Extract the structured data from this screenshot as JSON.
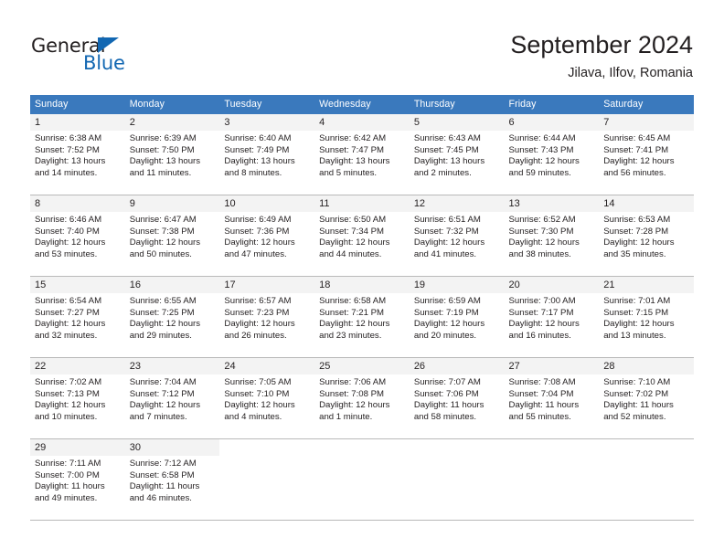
{
  "brand": {
    "name_top": "General",
    "name_bottom": "Blue",
    "triangle_icon": "blue-triangle-icon",
    "accent_color": "#1267b2"
  },
  "header": {
    "title": "September 2024",
    "location": "Jilava, Ilfov, Romania"
  },
  "theme": {
    "header_blue": "#3a79bd",
    "day_band_gray": "#f3f3f3",
    "grid_line": "#b9b9b9",
    "text": "#231f20"
  },
  "weekdays": [
    "Sunday",
    "Monday",
    "Tuesday",
    "Wednesday",
    "Thursday",
    "Friday",
    "Saturday"
  ],
  "weeks": [
    [
      {
        "day": "1",
        "sunrise": "Sunrise: 6:38 AM",
        "sunset": "Sunset: 7:52 PM",
        "daylight_1": "Daylight: 13 hours",
        "daylight_2": "and 14 minutes."
      },
      {
        "day": "2",
        "sunrise": "Sunrise: 6:39 AM",
        "sunset": "Sunset: 7:50 PM",
        "daylight_1": "Daylight: 13 hours",
        "daylight_2": "and 11 minutes."
      },
      {
        "day": "3",
        "sunrise": "Sunrise: 6:40 AM",
        "sunset": "Sunset: 7:49 PM",
        "daylight_1": "Daylight: 13 hours",
        "daylight_2": "and 8 minutes."
      },
      {
        "day": "4",
        "sunrise": "Sunrise: 6:42 AM",
        "sunset": "Sunset: 7:47 PM",
        "daylight_1": "Daylight: 13 hours",
        "daylight_2": "and 5 minutes."
      },
      {
        "day": "5",
        "sunrise": "Sunrise: 6:43 AM",
        "sunset": "Sunset: 7:45 PM",
        "daylight_1": "Daylight: 13 hours",
        "daylight_2": "and 2 minutes."
      },
      {
        "day": "6",
        "sunrise": "Sunrise: 6:44 AM",
        "sunset": "Sunset: 7:43 PM",
        "daylight_1": "Daylight: 12 hours",
        "daylight_2": "and 59 minutes."
      },
      {
        "day": "7",
        "sunrise": "Sunrise: 6:45 AM",
        "sunset": "Sunset: 7:41 PM",
        "daylight_1": "Daylight: 12 hours",
        "daylight_2": "and 56 minutes."
      }
    ],
    [
      {
        "day": "8",
        "sunrise": "Sunrise: 6:46 AM",
        "sunset": "Sunset: 7:40 PM",
        "daylight_1": "Daylight: 12 hours",
        "daylight_2": "and 53 minutes."
      },
      {
        "day": "9",
        "sunrise": "Sunrise: 6:47 AM",
        "sunset": "Sunset: 7:38 PM",
        "daylight_1": "Daylight: 12 hours",
        "daylight_2": "and 50 minutes."
      },
      {
        "day": "10",
        "sunrise": "Sunrise: 6:49 AM",
        "sunset": "Sunset: 7:36 PM",
        "daylight_1": "Daylight: 12 hours",
        "daylight_2": "and 47 minutes."
      },
      {
        "day": "11",
        "sunrise": "Sunrise: 6:50 AM",
        "sunset": "Sunset: 7:34 PM",
        "daylight_1": "Daylight: 12 hours",
        "daylight_2": "and 44 minutes."
      },
      {
        "day": "12",
        "sunrise": "Sunrise: 6:51 AM",
        "sunset": "Sunset: 7:32 PM",
        "daylight_1": "Daylight: 12 hours",
        "daylight_2": "and 41 minutes."
      },
      {
        "day": "13",
        "sunrise": "Sunrise: 6:52 AM",
        "sunset": "Sunset: 7:30 PM",
        "daylight_1": "Daylight: 12 hours",
        "daylight_2": "and 38 minutes."
      },
      {
        "day": "14",
        "sunrise": "Sunrise: 6:53 AM",
        "sunset": "Sunset: 7:28 PM",
        "daylight_1": "Daylight: 12 hours",
        "daylight_2": "and 35 minutes."
      }
    ],
    [
      {
        "day": "15",
        "sunrise": "Sunrise: 6:54 AM",
        "sunset": "Sunset: 7:27 PM",
        "daylight_1": "Daylight: 12 hours",
        "daylight_2": "and 32 minutes."
      },
      {
        "day": "16",
        "sunrise": "Sunrise: 6:55 AM",
        "sunset": "Sunset: 7:25 PM",
        "daylight_1": "Daylight: 12 hours",
        "daylight_2": "and 29 minutes."
      },
      {
        "day": "17",
        "sunrise": "Sunrise: 6:57 AM",
        "sunset": "Sunset: 7:23 PM",
        "daylight_1": "Daylight: 12 hours",
        "daylight_2": "and 26 minutes."
      },
      {
        "day": "18",
        "sunrise": "Sunrise: 6:58 AM",
        "sunset": "Sunset: 7:21 PM",
        "daylight_1": "Daylight: 12 hours",
        "daylight_2": "and 23 minutes."
      },
      {
        "day": "19",
        "sunrise": "Sunrise: 6:59 AM",
        "sunset": "Sunset: 7:19 PM",
        "daylight_1": "Daylight: 12 hours",
        "daylight_2": "and 20 minutes."
      },
      {
        "day": "20",
        "sunrise": "Sunrise: 7:00 AM",
        "sunset": "Sunset: 7:17 PM",
        "daylight_1": "Daylight: 12 hours",
        "daylight_2": "and 16 minutes."
      },
      {
        "day": "21",
        "sunrise": "Sunrise: 7:01 AM",
        "sunset": "Sunset: 7:15 PM",
        "daylight_1": "Daylight: 12 hours",
        "daylight_2": "and 13 minutes."
      }
    ],
    [
      {
        "day": "22",
        "sunrise": "Sunrise: 7:02 AM",
        "sunset": "Sunset: 7:13 PM",
        "daylight_1": "Daylight: 12 hours",
        "daylight_2": "and 10 minutes."
      },
      {
        "day": "23",
        "sunrise": "Sunrise: 7:04 AM",
        "sunset": "Sunset: 7:12 PM",
        "daylight_1": "Daylight: 12 hours",
        "daylight_2": "and 7 minutes."
      },
      {
        "day": "24",
        "sunrise": "Sunrise: 7:05 AM",
        "sunset": "Sunset: 7:10 PM",
        "daylight_1": "Daylight: 12 hours",
        "daylight_2": "and 4 minutes."
      },
      {
        "day": "25",
        "sunrise": "Sunrise: 7:06 AM",
        "sunset": "Sunset: 7:08 PM",
        "daylight_1": "Daylight: 12 hours",
        "daylight_2": "and 1 minute."
      },
      {
        "day": "26",
        "sunrise": "Sunrise: 7:07 AM",
        "sunset": "Sunset: 7:06 PM",
        "daylight_1": "Daylight: 11 hours",
        "daylight_2": "and 58 minutes."
      },
      {
        "day": "27",
        "sunrise": "Sunrise: 7:08 AM",
        "sunset": "Sunset: 7:04 PM",
        "daylight_1": "Daylight: 11 hours",
        "daylight_2": "and 55 minutes."
      },
      {
        "day": "28",
        "sunrise": "Sunrise: 7:10 AM",
        "sunset": "Sunset: 7:02 PM",
        "daylight_1": "Daylight: 11 hours",
        "daylight_2": "and 52 minutes."
      }
    ],
    [
      {
        "day": "29",
        "sunrise": "Sunrise: 7:11 AM",
        "sunset": "Sunset: 7:00 PM",
        "daylight_1": "Daylight: 11 hours",
        "daylight_2": "and 49 minutes."
      },
      {
        "day": "30",
        "sunrise": "Sunrise: 7:12 AM",
        "sunset": "Sunset: 6:58 PM",
        "daylight_1": "Daylight: 11 hours",
        "daylight_2": "and 46 minutes."
      },
      {
        "day": "",
        "sunrise": "",
        "sunset": "",
        "daylight_1": "",
        "daylight_2": ""
      },
      {
        "day": "",
        "sunrise": "",
        "sunset": "",
        "daylight_1": "",
        "daylight_2": ""
      },
      {
        "day": "",
        "sunrise": "",
        "sunset": "",
        "daylight_1": "",
        "daylight_2": ""
      },
      {
        "day": "",
        "sunrise": "",
        "sunset": "",
        "daylight_1": "",
        "daylight_2": ""
      },
      {
        "day": "",
        "sunrise": "",
        "sunset": "",
        "daylight_1": "",
        "daylight_2": ""
      }
    ]
  ]
}
